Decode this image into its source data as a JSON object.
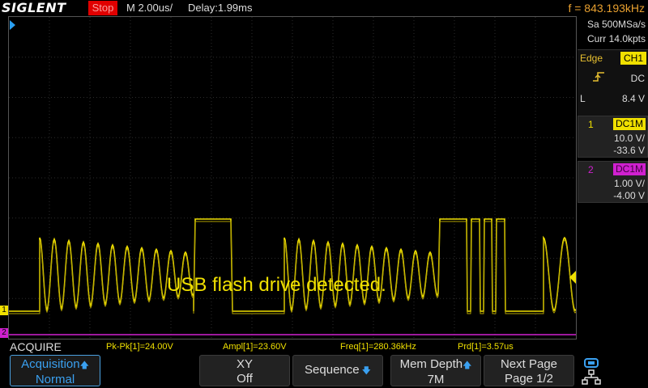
{
  "header": {
    "brand": "SIGLENT",
    "run_state": "Stop",
    "timebase": "M 2.00us/",
    "delay": "Delay:1.99ms",
    "frequency": "f = 843.193kHz"
  },
  "acquisition": {
    "sample_rate": "Sa 500MSa/s",
    "current_points": "Curr 14.0kpts"
  },
  "trigger": {
    "type": "Edge",
    "source": "CH1",
    "coupling": "DC",
    "level_label": "L",
    "level": "8.4 V",
    "slope_icon": "rising-edge-icon"
  },
  "channels": [
    {
      "num": "1",
      "coupling": "DC1M",
      "scale": "10.0 V/",
      "offset": "-33.6 V",
      "color": "#f0e000"
    },
    {
      "num": "2",
      "coupling": "DC1M",
      "scale": "1.00 V/",
      "offset": "-4.00 V",
      "color": "#d020d0"
    }
  ],
  "screen": {
    "overlay_message": "USB flash drive detected.",
    "ch1_marker": "1",
    "ch2_marker": "2"
  },
  "status": {
    "mode": "ACQUIRE"
  },
  "measurements": {
    "pkpk": "Pk-Pk[1]=24.00V",
    "ampl": "Ampl[1]=23.60V",
    "freq": "Freq[1]=280.36kHz",
    "prd": "Prd[1]=3.57us"
  },
  "softkeys": [
    {
      "line1": "Acquisition",
      "line2": "Normal"
    },
    {
      "line1": "XY",
      "line2": "Off"
    },
    {
      "line1": "Sequence",
      "line2": ""
    },
    {
      "line1": "Mem Depth",
      "line2": "7M"
    },
    {
      "line1": "Next Page",
      "line2": "Page 1/2"
    }
  ]
}
